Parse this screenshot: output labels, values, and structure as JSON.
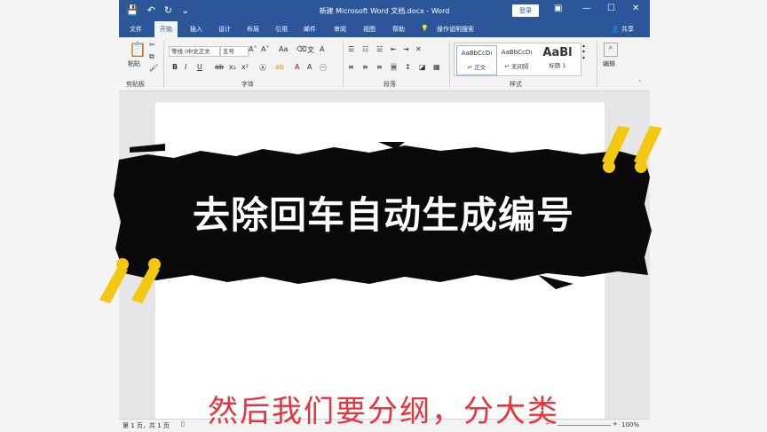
{
  "titlebar": {
    "title": "新建 Microsoft Word 文档.docx - Word",
    "login": "登录",
    "quick_access": [
      "💾",
      "↶",
      "↻",
      "⌄"
    ]
  },
  "tabs": [
    "文件",
    "开始",
    "插入",
    "设计",
    "布局",
    "引用",
    "邮件",
    "审阅",
    "视图",
    "帮助"
  ],
  "tell_me": "操作说明搜索",
  "share": "共享",
  "ribbon": {
    "paste": "粘贴",
    "clipboard": "剪贴板",
    "font_name": "等线 (中文正文",
    "font_size": "五号",
    "font": "字体",
    "paragraph": "段落",
    "styles_label": "样式",
    "editing": "编辑",
    "styles": [
      {
        "preview": "AaBbCcDı",
        "name": "↵ 正文"
      },
      {
        "preview": "AaBbCcDı",
        "name": "↵ 无间隔"
      },
      {
        "preview": "AaBl",
        "name": "标题 1"
      }
    ]
  },
  "status": {
    "page": "第 1 页，共 1 页",
    "zoom": "100%"
  },
  "overlay": {
    "headline": "去除回车自动生成编号",
    "subtitle": "然后我们要分纲，分大类"
  },
  "colors": {
    "word_blue": "#2b579a",
    "quote_yellow": "#f2c811",
    "subtitle_red": "#e8333f"
  }
}
